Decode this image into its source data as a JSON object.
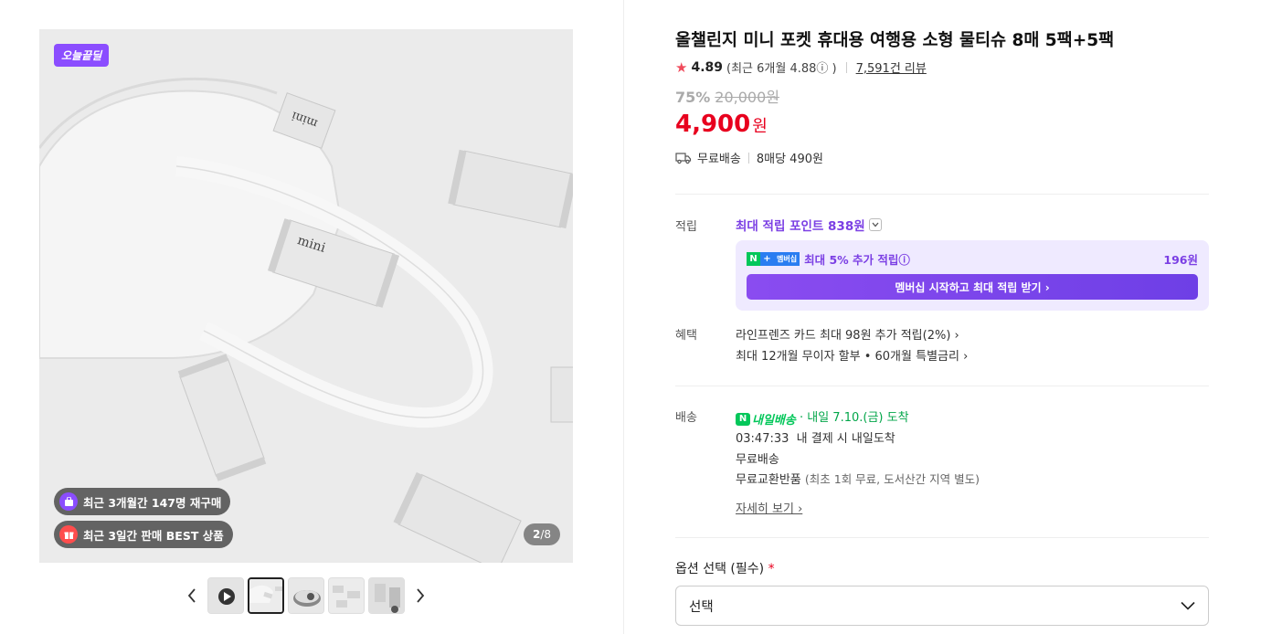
{
  "gallery": {
    "badge": "오늘끝딜",
    "pill_repurchase": "최근 3개월간 147명 재구매",
    "pill_best": "최근 3일간 판매 BEST 상품",
    "counter_current": "2",
    "counter_total": "/8",
    "product_mark": "mini",
    "thumb_count": 5,
    "active_thumb": 2
  },
  "product": {
    "title": "올챌린지 미니 포켓 휴대용 여행용 소형 물티슈 8매 5팩+5팩",
    "rating": "4.89",
    "rating_sub": "(최근 6개월 4.88ⓘ )",
    "reviews": "7,591건 리뷰",
    "discount": "75%",
    "original_price": "20,000원",
    "price": "4,900",
    "price_unit": "원",
    "shipping": "무료배송",
    "unit_price": "8매당 490원"
  },
  "points": {
    "label": "적립",
    "headline": "최대 적립 포인트 838원",
    "member_text": "최대 5% 추가 적립ⓘ",
    "member_badge": "멤버십",
    "member_amount": "196원",
    "member_button": "멤버십 시작하고 최대 적립 받기 ›"
  },
  "benefits": {
    "label": "혜택",
    "items": [
      "라인프렌즈 카드 최대 98원 추가 적립(2%) ›",
      "최대 12개월 무이자 할부 • 60개월 특별금리 ›"
    ]
  },
  "delivery": {
    "label": "배송",
    "service": "내일배송",
    "arrival": "· 내일 7.10.(금) 도착",
    "countdown": "03:47:33",
    "countdown_note": "내 결제 시 내일도착",
    "free_shipping": "무료배송",
    "returns": "무료교환반품",
    "returns_note": "(최초 1회 무료, 도서산간 지역 별도)",
    "more": "자세히 보기 ›"
  },
  "options": {
    "label": "옵션 선택 (필수)",
    "required_mark": "*",
    "select_value": "선택"
  },
  "colors": {
    "accent_purple": "#7b3fe4",
    "price_red": "#e8001e",
    "naver_green": "#03c75a"
  }
}
